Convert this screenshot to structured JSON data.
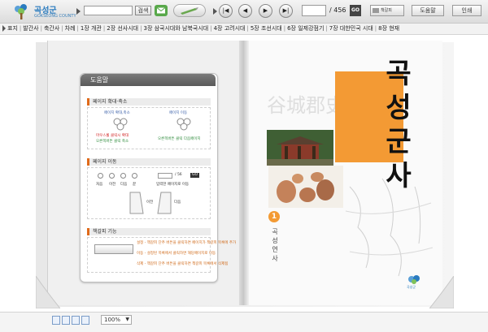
{
  "app": {
    "logo_name": "곡성군",
    "logo_sub": "GOKSEONG COUNTY"
  },
  "toolbar": {
    "search_placeholder": "",
    "search_label": "검색",
    "page_current": "",
    "page_total": "/ 456",
    "go_label": "GO",
    "view_toggle_label": "책갈피",
    "help_label": "도움말",
    "print_label": "인쇄"
  },
  "chapters": [
    "표지",
    "발간사",
    "축간사",
    "차례",
    "1장 개관",
    "2장 선사시대",
    "3장 삼국시대와 남북국시대",
    "4장 고려시대",
    "5장 조선시대",
    "6장 일제강점기",
    "7장 대한민국 시대",
    "8장 현재"
  ],
  "help_panel": {
    "title": "도움말",
    "sec1": {
      "head": "페이지 확대·축소",
      "zoom_label": "페이지 확대,축소",
      "move_label": "페이지 이동",
      "desc1": "마우스휠 클릭시 확대",
      "desc2": "오른쪽버튼 클릭 축소",
      "desc3": "오른쪽버튼 클릭 다음페이지"
    },
    "sec2": {
      "head": "페이지 이동",
      "page_total": "/ 56",
      "go": "GO",
      "labels": [
        "처음",
        "이전",
        "다음",
        "끝",
        "입력한 페이지로 이동"
      ],
      "prev": "이전",
      "next": "다음"
    },
    "sec3": {
      "head": "책갈피 기능",
      "line1": "설정 - 책갈피 단추 버튼을 클릭하면 페이지가 책갈피 목록에 추가",
      "line2": "이동 - 설정된 목록에서 클릭하면 해당페이지로 이동",
      "line3": "삭제 - 책갈피 단추 버튼을 클릭하면 책갈피 목록에서 삭제됨"
    }
  },
  "cover": {
    "bg_text": "谷城郡史",
    "title": "곡성군사",
    "volume_number": "1",
    "volume_title": "곡성연사",
    "seal_label": "곡성군"
  },
  "zoom": {
    "value": "100%"
  },
  "colors": {
    "accent": "#f39a34",
    "logo_blue": "#2a7bbf",
    "green": "#58a84a"
  }
}
